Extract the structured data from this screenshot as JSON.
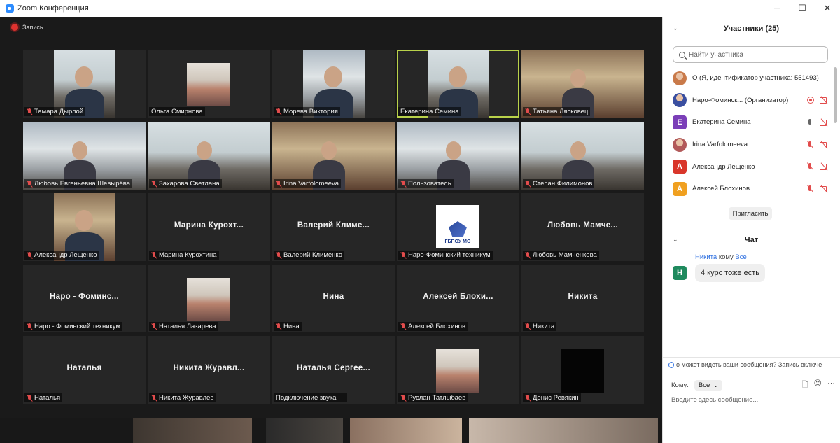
{
  "window": {
    "title": "Zoom Конференция",
    "controls": {
      "minimize": "─",
      "maximize": "☐",
      "close": "✕"
    }
  },
  "recording": {
    "label": "Запись"
  },
  "tiles": [
    {
      "name": "Тамара Дырлой",
      "muted": true,
      "video": true
    },
    {
      "name": "Ольга Смирнова",
      "muted": false,
      "video": false,
      "photo": true
    },
    {
      "name": "Морева Виктория",
      "muted": true,
      "video": true
    },
    {
      "name": "Екатерина Семина",
      "muted": false,
      "video": true,
      "active": true
    },
    {
      "name": "Татьяна Лясковец",
      "muted": true,
      "video": true
    },
    {
      "name": "Любовь Евгеньевна Шевырёва",
      "muted": true,
      "video": true
    },
    {
      "name": "Захарова Светлана",
      "muted": true,
      "video": true
    },
    {
      "name": "Irina Varfolomeeva",
      "muted": true,
      "video": true
    },
    {
      "name": "Пользователь",
      "muted": true,
      "video": true
    },
    {
      "name": "Степан Филимонов",
      "muted": true,
      "video": true
    },
    {
      "name": "Александр Лещенко",
      "muted": true,
      "video": true
    },
    {
      "name": "Марина Курохтина",
      "muted": true,
      "video": false,
      "display": "Марина  Курохт..."
    },
    {
      "name": "Валерий Клименко",
      "muted": true,
      "video": false,
      "display": "Валерий  Климе..."
    },
    {
      "name": "Наро-Фоминский техникум",
      "muted": true,
      "video": false,
      "logo": "ГБПОУ МО"
    },
    {
      "name": "Любовь Мамченкова",
      "muted": true,
      "video": false,
      "display": "Любовь  Мамче..."
    },
    {
      "name": "Наро - Фоминский техникум",
      "muted": true,
      "video": false,
      "display": "Наро  -  Фоминс..."
    },
    {
      "name": "Наталья Лазарева",
      "muted": true,
      "video": false,
      "photo": true
    },
    {
      "name": "Нина",
      "muted": true,
      "video": false,
      "display": "Нина"
    },
    {
      "name": "Алексей Блохинов",
      "muted": true,
      "video": false,
      "display": "Алексей  Блохи..."
    },
    {
      "name": "Никита",
      "muted": true,
      "video": false,
      "display": "Никита"
    },
    {
      "name": "Наталья",
      "muted": true,
      "video": false,
      "display": "Наталья"
    },
    {
      "name": "Никита Журавлев",
      "muted": true,
      "video": false,
      "display": "Никита  Журавл..."
    },
    {
      "name": "Подключение звука ···",
      "muted": false,
      "video": false,
      "display": "Наталья  Сергее..."
    },
    {
      "name": "Руслан Татлыбаев",
      "muted": true,
      "video": false,
      "photo": true
    },
    {
      "name": "Денис Ревякин",
      "muted": true,
      "video": false,
      "photo": true
    }
  ],
  "participants_panel": {
    "title": "Участники (25)",
    "search_placeholder": "Найти участника",
    "participants": [
      {
        "name": "О (Я, идентификатор участника: 551493)",
        "avatar": "",
        "color": "#c97a4a"
      },
      {
        "name": "Наро-Фоминск...  (Организатор)",
        "avatar": "",
        "color": "#3a4fa0",
        "icons": [
          "rec-icon",
          "cam-muted-icon"
        ]
      },
      {
        "name": "Екатерина Семина",
        "avatar": "E",
        "color": "#7b3fb8",
        "icons": [
          "mic-icon",
          "cam-muted-icon"
        ]
      },
      {
        "name": "Irina Varfolomeeva",
        "avatar": "",
        "color": "#b25a5a",
        "icons": [
          "mic-muted-icon",
          "cam-muted-icon"
        ]
      },
      {
        "name": "Александр Лещенко",
        "avatar": "A",
        "color": "#d9362b",
        "icons": [
          "mic-muted-icon",
          "cam-muted-icon"
        ]
      },
      {
        "name": "Алексей Блохинов",
        "avatar": "A",
        "color": "#f0a020",
        "icons": [
          "mic-muted-icon",
          "cam-muted-icon"
        ]
      }
    ],
    "invite_label": "Пригласить"
  },
  "chat_panel": {
    "title": "Чат",
    "message": {
      "sender": "Никита",
      "to_prefix": "кому",
      "recipient": "Все",
      "avatar": "H",
      "avatar_color": "#1f8a5e",
      "text": "4 курс тоже есть"
    },
    "notice": "о может видеть ваши сообщения? Запись включе",
    "to_label": "Кому:",
    "to_value": "Все",
    "input_placeholder": "Введите здесь сообщение..."
  }
}
